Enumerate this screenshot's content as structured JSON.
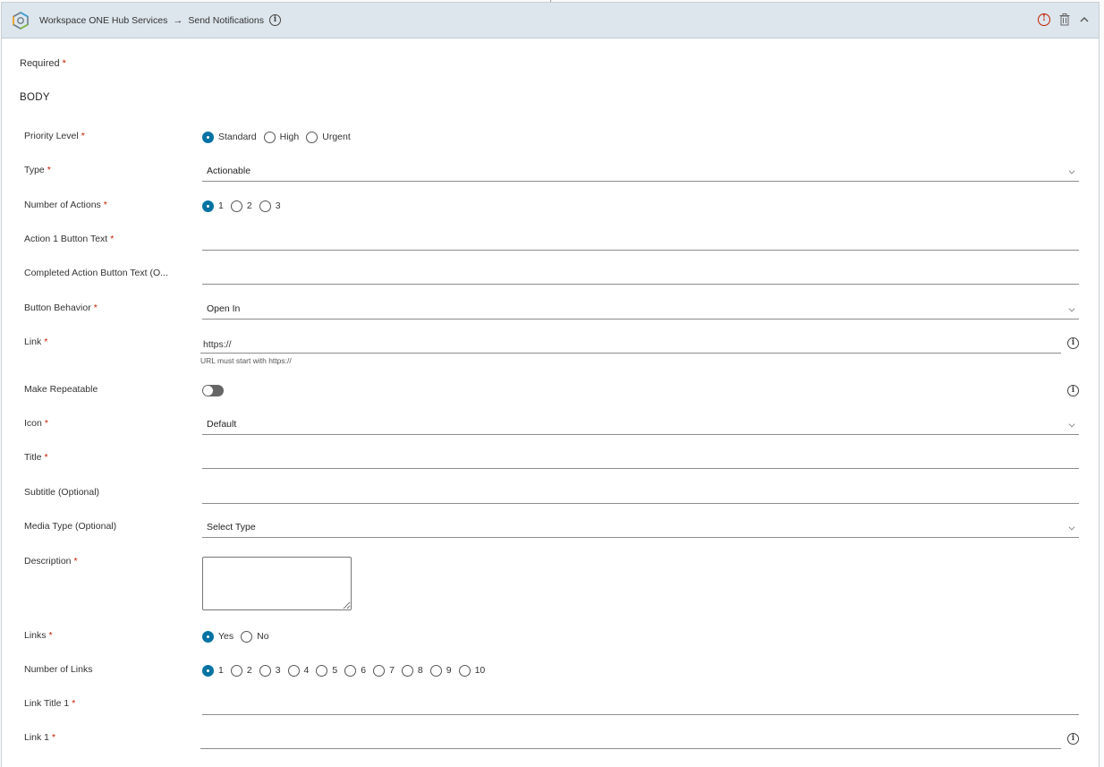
{
  "header": {
    "breadcrumb_app": "Workspace ONE Hub Services",
    "breadcrumb_arrow": "→",
    "breadcrumb_page": "Send Notifications",
    "info_glyph": "i",
    "error_glyph": "!"
  },
  "form": {
    "required_label": "Required",
    "required_star": "*",
    "section_title": "BODY",
    "priority": {
      "label": "Priority Level",
      "options": [
        "Standard",
        "High",
        "Urgent"
      ],
      "selected": "Standard"
    },
    "type": {
      "label": "Type",
      "value": "Actionable"
    },
    "num_actions": {
      "label": "Number of Actions",
      "options": [
        "1",
        "2",
        "3"
      ],
      "selected": "1"
    },
    "action1_text": {
      "label": "Action 1 Button Text",
      "value": ""
    },
    "completed_text": {
      "label": "Completed Action Button Text (O...",
      "value": ""
    },
    "button_behavior": {
      "label": "Button Behavior",
      "value": "Open In"
    },
    "link": {
      "label": "Link",
      "value": "https://",
      "helper": "URL must start with https://"
    },
    "make_repeatable": {
      "label": "Make Repeatable",
      "on": false
    },
    "icon": {
      "label": "Icon",
      "value": "Default"
    },
    "title": {
      "label": "Title",
      "value": ""
    },
    "subtitle": {
      "label": "Subtitle (Optional)",
      "value": ""
    },
    "media_type": {
      "label": "Media Type (Optional)",
      "value": "Select Type"
    },
    "description": {
      "label": "Description",
      "value": ""
    },
    "links": {
      "label": "Links",
      "options": [
        "Yes",
        "No"
      ],
      "selected": "Yes"
    },
    "num_links": {
      "label": "Number of Links",
      "options": [
        "1",
        "2",
        "3",
        "4",
        "5",
        "6",
        "7",
        "8",
        "9",
        "10"
      ],
      "selected": "1"
    },
    "link_title_1": {
      "label": "Link Title 1",
      "value": ""
    },
    "link_1": {
      "label": "Link 1",
      "value": ""
    }
  },
  "colors": {
    "accent": "#0072a3",
    "required": "#c21d00",
    "header_bg": "#dde6ed"
  }
}
